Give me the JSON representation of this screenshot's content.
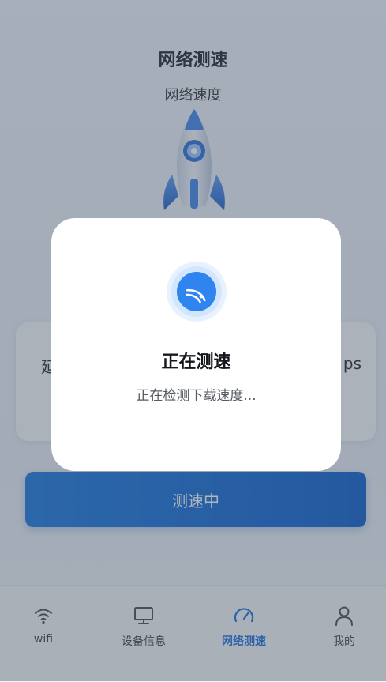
{
  "header": {
    "title": "网络测速",
    "subtitle": "网络速度"
  },
  "result_card": {
    "left_label": "延",
    "right_label": "ps"
  },
  "action_button": {
    "label": "测速中"
  },
  "dialog": {
    "icon": "wifi-signal-icon",
    "title": "正在测速",
    "message": "正在检测下载速度..."
  },
  "bottom_nav": {
    "items": [
      {
        "label": "wifi",
        "icon": "wifi-icon",
        "active": false
      },
      {
        "label": "设备信息",
        "icon": "monitor-icon",
        "active": false
      },
      {
        "label": "网络测速",
        "icon": "speedometer-icon",
        "active": true
      },
      {
        "label": "我的",
        "icon": "user-icon",
        "active": false
      }
    ]
  },
  "colors": {
    "accent": "#1b6ee0",
    "button": "#1b78e0",
    "overlay": "rgba(70,80,95,0.42)"
  }
}
